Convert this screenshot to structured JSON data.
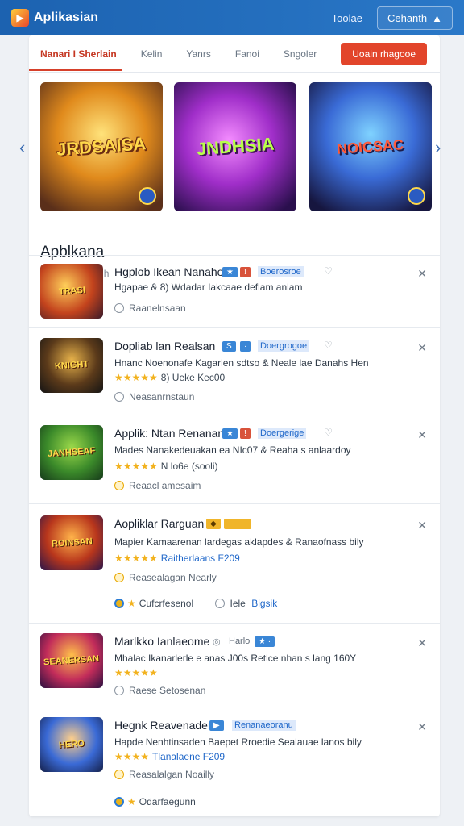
{
  "header": {
    "title": "Aplikasian",
    "link": "Toolae",
    "button": "Cehanth"
  },
  "tabs": {
    "items": [
      "Nanari I Sherlain",
      "Kelin",
      "Yanrs",
      "Fanoi",
      "Sngoler"
    ],
    "cta": "Uoain rhagooe"
  },
  "banners": [
    {
      "title": "JRDSAISA"
    },
    {
      "title": "JNDHSIA"
    },
    {
      "title": "NOICSAC"
    }
  ],
  "section": {
    "title": "Apblkana",
    "subtitle": "Sepakosn Hagh"
  },
  "apps": [
    {
      "name": "Hgplob Ikean Nanaho",
      "tag_link": "Boerosroe",
      "desc": "Hgapae & 8) Wdadar Iakcaae deflam anlam",
      "rating": "",
      "meta": "Raanelnsaan",
      "icon": "TRASI"
    },
    {
      "name": "Dopliab lan Realsan",
      "tag_link": "Doergrogoe",
      "desc": "Hnanc Noenonafe Kagarlen sdtso & Neale lae Danahs Hen",
      "rating": "8) Ueke Kec00",
      "meta": "Neasanrnstaun",
      "icon": "KNIGHT"
    },
    {
      "name": "Applik: Ntan Renanan",
      "tag_link": "Doergerige",
      "desc": "Mades Nanakedeuakan ea NIc07 & Reaha s anlaardoy",
      "rating": "N lo6e (sooli)",
      "meta": "Reaacl amesaim",
      "icon": "JANHSEAF"
    },
    {
      "name": "Aopliklar Rarguan",
      "tag_link": "",
      "desc": "Mapier Kamaarenan lardegas aklapdes & Ranaofnass bily",
      "rating": "Raitherlaans F209",
      "meta": "Reasealagan Nearly",
      "icon": "ROINSAN",
      "extra": {
        "left": "Cufcrfesenol",
        "right_prefix": "Iele",
        "right_link": "Bigsik"
      }
    },
    {
      "name": "Marlkko Ianlaeome",
      "tag_text": "Harlo",
      "tag_link": "",
      "desc": "Mhalac Ikanarlerle e anas J00s Retlce nhan s lang 160Y",
      "rating": "",
      "meta": "Raese Setosenan",
      "icon": "SEANERSAN"
    },
    {
      "name": "Hegnk Reavenader",
      "tag_link": "Renanaeoranu",
      "desc": "Hapde Nenhtinsaden Baepet Rroedie Sealauae lanos bily",
      "rating": "Tlanalaene F209",
      "meta": "Reasalalgan Noailly",
      "icon": "HERO",
      "extra": {
        "left": "Odarfaegunn",
        "right_prefix": "",
        "right_link": ""
      }
    }
  ],
  "colors": {
    "header": "#1c62b0",
    "accent": "#e2452b",
    "star": "#f2b21e"
  }
}
